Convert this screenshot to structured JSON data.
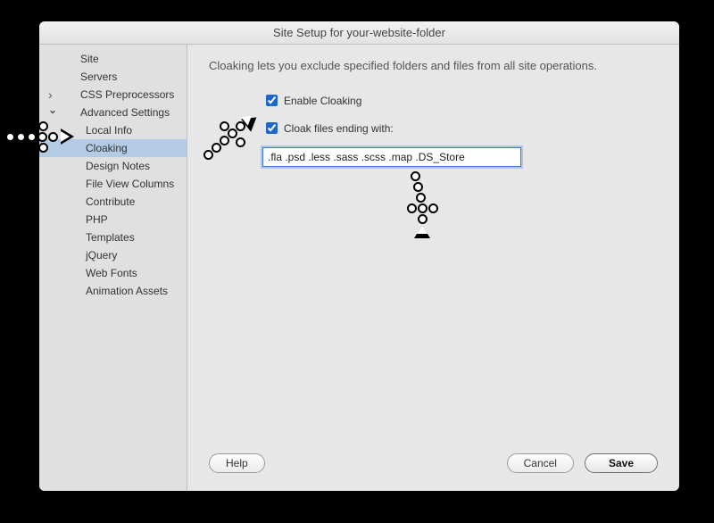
{
  "title": "Site Setup for your-website-folder",
  "sidebar": {
    "items": [
      {
        "label": "Site",
        "level": 0,
        "has_children": false,
        "expanded": false,
        "selected": false
      },
      {
        "label": "Servers",
        "level": 0,
        "has_children": false,
        "expanded": false,
        "selected": false
      },
      {
        "label": "CSS Preprocessors",
        "level": 0,
        "has_children": true,
        "expanded": false,
        "selected": false
      },
      {
        "label": "Advanced Settings",
        "level": 0,
        "has_children": true,
        "expanded": true,
        "selected": false
      },
      {
        "label": "Local Info",
        "level": 1,
        "has_children": false,
        "expanded": false,
        "selected": false
      },
      {
        "label": "Cloaking",
        "level": 1,
        "has_children": false,
        "expanded": false,
        "selected": true
      },
      {
        "label": "Design Notes",
        "level": 1,
        "has_children": false,
        "expanded": false,
        "selected": false
      },
      {
        "label": "File View Columns",
        "level": 1,
        "has_children": false,
        "expanded": false,
        "selected": false
      },
      {
        "label": "Contribute",
        "level": 1,
        "has_children": false,
        "expanded": false,
        "selected": false
      },
      {
        "label": "PHP",
        "level": 1,
        "has_children": false,
        "expanded": false,
        "selected": false
      },
      {
        "label": "Templates",
        "level": 1,
        "has_children": false,
        "expanded": false,
        "selected": false
      },
      {
        "label": "jQuery",
        "level": 1,
        "has_children": false,
        "expanded": false,
        "selected": false
      },
      {
        "label": "Web Fonts",
        "level": 1,
        "has_children": false,
        "expanded": false,
        "selected": false
      },
      {
        "label": "Animation Assets",
        "level": 1,
        "has_children": false,
        "expanded": false,
        "selected": false
      }
    ]
  },
  "main": {
    "description": "Cloaking lets you exclude specified folders and files from all site operations.",
    "enable_cloaking_label": "Enable Cloaking",
    "enable_cloaking_checked": true,
    "cloak_files_label": "Cloak files ending with:",
    "cloak_files_checked": true,
    "extensions_value": ".fla .psd .less .sass .scss .map .DS_Store"
  },
  "buttons": {
    "help": "Help",
    "cancel": "Cancel",
    "save": "Save"
  }
}
